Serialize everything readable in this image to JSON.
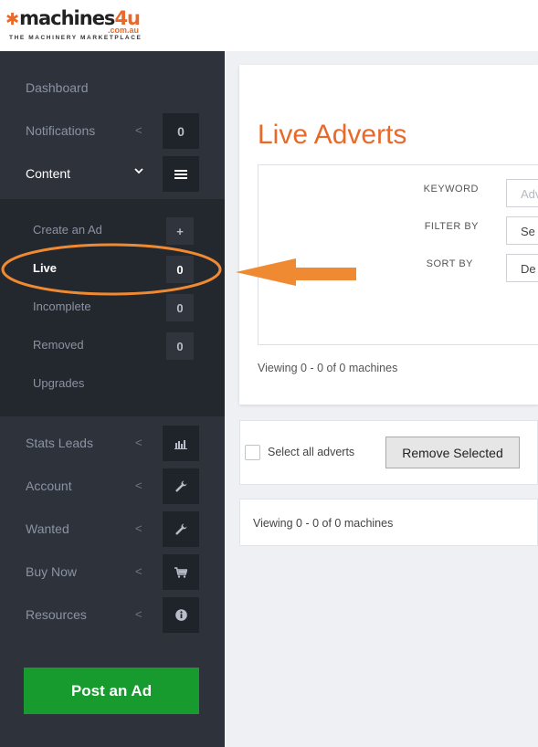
{
  "brand": {
    "logo_main": "machines",
    "logo_four": "4u",
    "logo_domain": ".com.au",
    "tagline": "THE MACHINERY MARKETPLACE"
  },
  "sidebar": {
    "items": [
      {
        "label": "Dashboard",
        "badge": ""
      },
      {
        "label": "Notifications",
        "badge": "0"
      },
      {
        "label": "Content",
        "badge": ""
      },
      {
        "label": "Stats Leads",
        "badge": ""
      },
      {
        "label": "Account",
        "badge": ""
      },
      {
        "label": "Wanted",
        "badge": ""
      },
      {
        "label": "Buy Now",
        "badge": ""
      },
      {
        "label": "Resources",
        "badge": ""
      }
    ],
    "submenu": [
      {
        "label": "Create an Ad",
        "badge": "+"
      },
      {
        "label": "Live",
        "badge": "0"
      },
      {
        "label": "Incomplete",
        "badge": "0"
      },
      {
        "label": "Removed",
        "badge": "0"
      },
      {
        "label": "Upgrades",
        "badge": ""
      }
    ],
    "post_button": "Post an Ad"
  },
  "main": {
    "title": "Live Adverts",
    "filters": {
      "keyword_label": "KEYWORD",
      "keyword_placeholder": "Adv",
      "filter_label": "FILTER BY",
      "filter_value": "Se",
      "sort_label": "SORT BY",
      "sort_value": "De"
    },
    "viewing_top": "Viewing 0 - 0 of 0 machines",
    "select_all": "Select all adverts",
    "remove_selected": "Remove Selected",
    "viewing_bottom": "Viewing 0 - 0 of 0 machines"
  },
  "colors": {
    "accent": "#e8692a",
    "sidebar_bg": "#2d323b",
    "submenu_bg": "#23272e",
    "post_button": "#179b2f"
  },
  "icons": {
    "content": "menu-icon",
    "stats": "bar-chart-icon",
    "account": "wrench-icon",
    "wanted": "wrench-icon",
    "buy_now": "cart-icon",
    "resources": "info-icon"
  }
}
